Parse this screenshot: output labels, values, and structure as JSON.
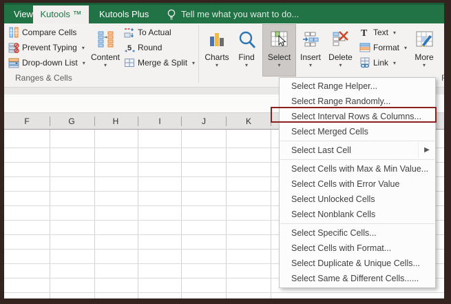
{
  "tabs": {
    "view": "View",
    "kutools": "Kutools ™",
    "kutools_plus": "Kutools Plus",
    "tell_me": "Tell me what you want to do..."
  },
  "ribbon": {
    "compare_cells": "Compare Cells",
    "prevent_typing": "Prevent Typing",
    "dropdown_list": "Drop-down List",
    "content": "Content",
    "to_actual": "To Actual",
    "round": "Round",
    "merge_split": "Merge & Split",
    "charts": "Charts",
    "find": "Find",
    "select": "Select",
    "insert": "Insert",
    "delete": "Delete",
    "text": "Text",
    "format": "Format",
    "link": "Link",
    "more": "More",
    "group_label": "Ranges & Cells",
    "clipped_group_label": "F"
  },
  "menu": {
    "items": [
      {
        "label": "Select Range Helper..."
      },
      {
        "label": "Select Range Randomly..."
      },
      {
        "label": "Select Interval Rows & Columns...",
        "highlighted": true
      },
      {
        "label": "Select Merged Cells"
      },
      {
        "label": "Select Last Cell",
        "submenu": true
      },
      {
        "label": "Select Cells with Max & Min Value..."
      },
      {
        "label": "Select Cells with Error Value"
      },
      {
        "label": "Select Unlocked Cells"
      },
      {
        "label": "Select Nonblank Cells"
      },
      {
        "label": "Select Specific Cells..."
      },
      {
        "label": "Select Cells with Format..."
      },
      {
        "label": "Select Duplicate & Unique Cells..."
      },
      {
        "label": "Select Same & Different Cells......"
      }
    ]
  },
  "sheet": {
    "columns": [
      "F",
      "G",
      "H",
      "I",
      "J",
      "K"
    ]
  },
  "colors": {
    "excel_green": "#217346",
    "active_tab_text": "#217346",
    "annotation_red": "#8B1F1B",
    "pressed_button_bg": "#CCC9C7",
    "chart_bar_blue": "#4A72B8",
    "chart_bar_yellow": "#F0B942",
    "chart_bar_gray": "#6D6D6D"
  }
}
